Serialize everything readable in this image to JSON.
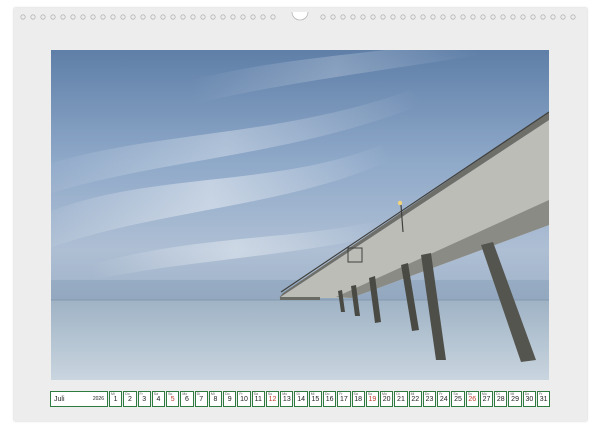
{
  "calendar": {
    "month": "Juli",
    "year": "2026",
    "days": [
      {
        "n": "1",
        "w": "Mi"
      },
      {
        "n": "2",
        "w": "Do"
      },
      {
        "n": "3",
        "w": "Fr"
      },
      {
        "n": "4",
        "w": "Sa"
      },
      {
        "n": "5",
        "w": "So"
      },
      {
        "n": "6",
        "w": "Mo"
      },
      {
        "n": "7",
        "w": "Di"
      },
      {
        "n": "8",
        "w": "Mi"
      },
      {
        "n": "9",
        "w": "Do"
      },
      {
        "n": "10",
        "w": "Fr"
      },
      {
        "n": "11",
        "w": "Sa"
      },
      {
        "n": "12",
        "w": "So"
      },
      {
        "n": "13",
        "w": "Mo"
      },
      {
        "n": "14",
        "w": "Di"
      },
      {
        "n": "15",
        "w": "Mi"
      },
      {
        "n": "16",
        "w": "Do"
      },
      {
        "n": "17",
        "w": "Fr"
      },
      {
        "n": "18",
        "w": "Sa"
      },
      {
        "n": "19",
        "w": "So"
      },
      {
        "n": "20",
        "w": "Mo"
      },
      {
        "n": "21",
        "w": "Di"
      },
      {
        "n": "22",
        "w": "Mi"
      },
      {
        "n": "23",
        "w": "Do"
      },
      {
        "n": "24",
        "w": "Fr"
      },
      {
        "n": "25",
        "w": "Sa"
      },
      {
        "n": "26",
        "w": "So"
      },
      {
        "n": "27",
        "w": "Mo"
      },
      {
        "n": "28",
        "w": "Di"
      },
      {
        "n": "29",
        "w": "Mi"
      },
      {
        "n": "30",
        "w": "Do"
      },
      {
        "n": "31",
        "w": "Fr"
      }
    ],
    "sunday_color": "#c0392b",
    "border_color": "#2f7a3e"
  },
  "photo": {
    "subject": "pier-long-exposure"
  }
}
